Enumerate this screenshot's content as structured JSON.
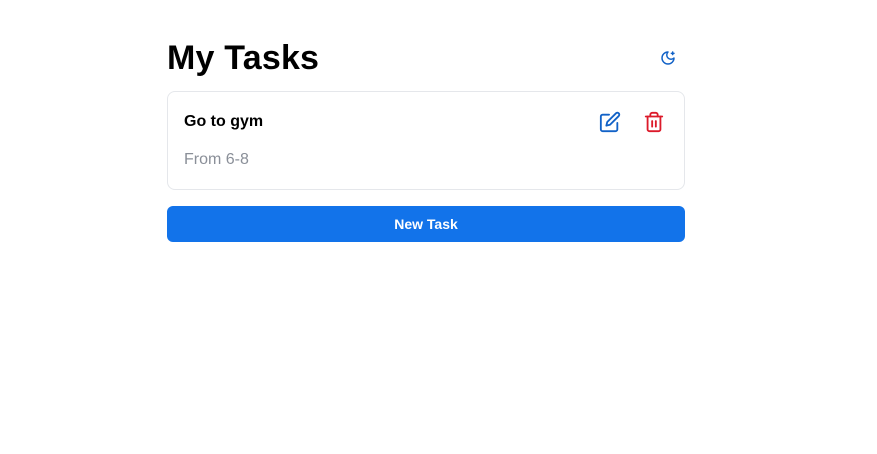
{
  "header": {
    "title": "My Tasks",
    "theme_icon": "moon-icon"
  },
  "tasks": [
    {
      "title": "Go to gym",
      "description": "From 6-8",
      "edit_icon": "edit-icon",
      "delete_icon": "trash-icon"
    }
  ],
  "actions": {
    "new_task_label": "New Task"
  },
  "colors": {
    "primary": "#1273ea",
    "danger": "#dc2626",
    "muted_text": "#8a8f98",
    "border": "#e5e7eb"
  }
}
